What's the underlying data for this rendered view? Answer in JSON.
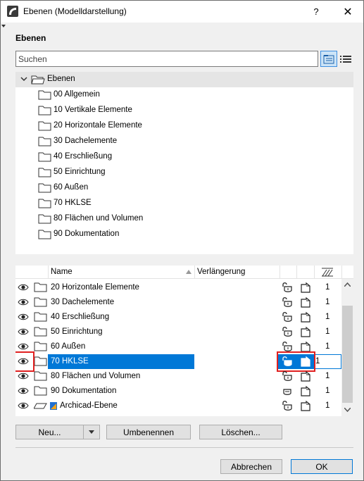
{
  "window": {
    "title": "Ebenen (Modelldarstellung)",
    "help_label": "?",
    "close_label": "✕"
  },
  "section_title": "Ebenen",
  "search": {
    "placeholder": "Suchen",
    "value": ""
  },
  "tree": {
    "root_label": "Ebenen",
    "items": [
      "00 Allgemein",
      "10 Vertikale Elemente",
      "20 Horizontale Elemente",
      "30 Dachelemente",
      "40 Erschließung",
      "50 Einrichtung",
      "60 Außen",
      "70 HKLSE",
      "80 Flächen und Volumen",
      "90 Dokumentation"
    ]
  },
  "table": {
    "columns": {
      "name": "Name",
      "extension": "Verlängerung"
    },
    "rows": [
      {
        "name": "20 Horizontale Elemente",
        "num": "1",
        "icon": "folder-icon",
        "lock": "unlocked"
      },
      {
        "name": "30 Dachelemente",
        "num": "1",
        "icon": "folder-icon",
        "lock": "unlocked"
      },
      {
        "name": "40 Erschließung",
        "num": "1",
        "icon": "folder-icon",
        "lock": "unlocked"
      },
      {
        "name": "50 Einrichtung",
        "num": "1",
        "icon": "folder-icon",
        "lock": "unlocked"
      },
      {
        "name": "60 Außen",
        "num": "1",
        "icon": "folder-icon",
        "lock": "unlocked"
      },
      {
        "name": "70 HKLSE",
        "num": "1",
        "icon": "folder-icon",
        "lock": "unlocked",
        "selected": true
      },
      {
        "name": "80 Flächen und Volumen",
        "num": "1",
        "icon": "folder-icon",
        "lock": "unlocked"
      },
      {
        "name": "90 Dokumentation",
        "num": "1",
        "icon": "folder-icon",
        "lock": "locked"
      },
      {
        "name": "Archicad-Ebene",
        "num": "1",
        "icon": "archicad-layer-icon",
        "lock": "unlocked"
      }
    ]
  },
  "buttons": {
    "new": "Neu...",
    "rename": "Umbenennen",
    "delete": "Löschen...",
    "cancel": "Abbrechen",
    "ok": "OK"
  },
  "colors": {
    "selection": "#0078d7",
    "highlight": "#e02020"
  }
}
